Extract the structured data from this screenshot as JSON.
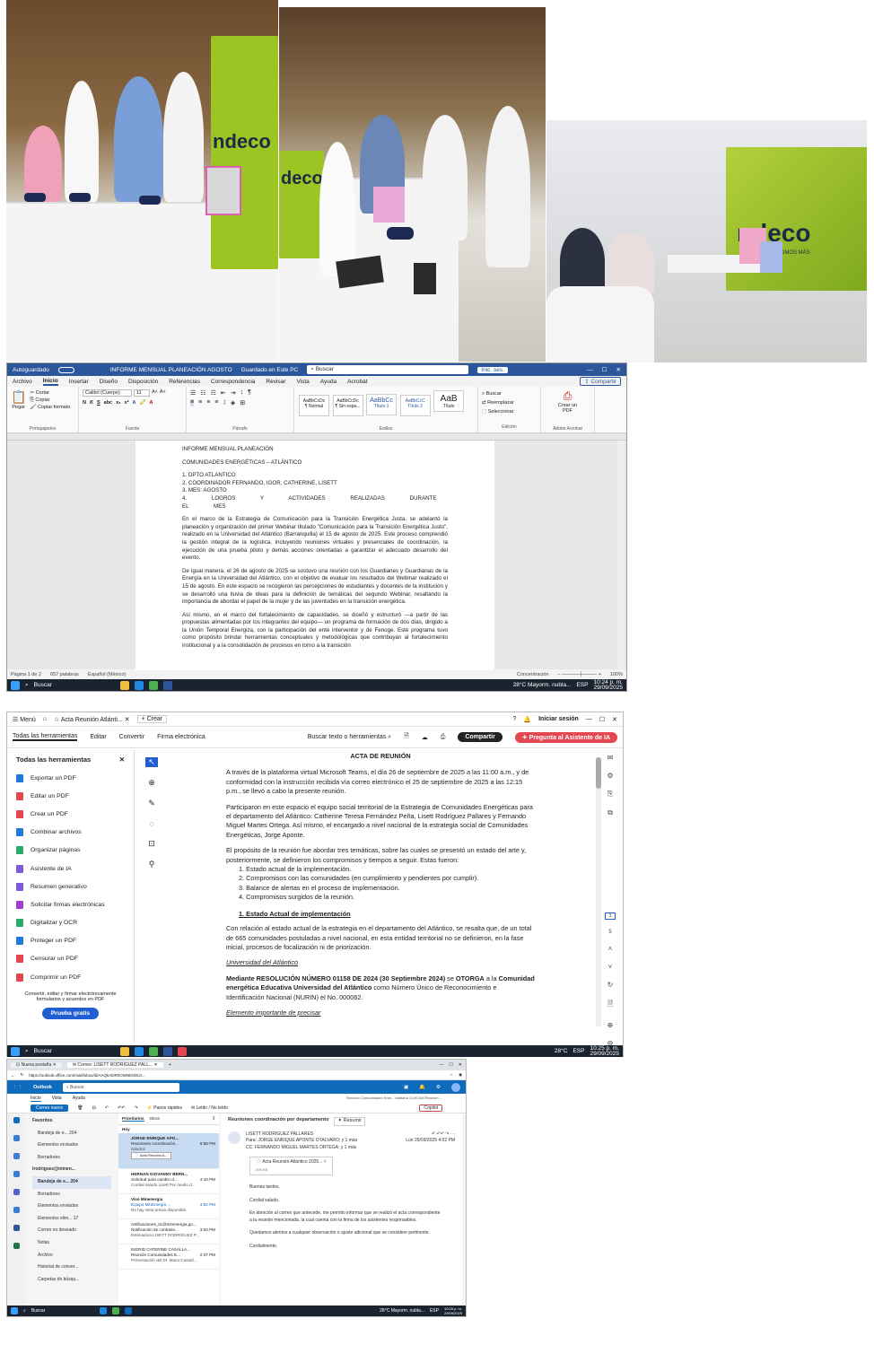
{
  "photos": {
    "banner_logo": "ndeco",
    "banner_sub": "UNIDOS, SOMOS MÁS"
  },
  "word": {
    "autosave": "Autoguardado",
    "doc_title": "INFORME MENSUAL PLANEACIÓN AGOSTO",
    "saved": "Guardado en Este PC",
    "search": "Buscar",
    "signin": "Inic. ses.",
    "share": "Compartir",
    "tabs": [
      "Archivo",
      "Inicio",
      "Insertar",
      "Diseño",
      "Disposición",
      "Referencias",
      "Correspondencia",
      "Revisar",
      "Vista",
      "Ayuda",
      "Acrobat"
    ],
    "ribbon": {
      "paste": "Pegar",
      "cut": "Cortar",
      "copy": "Copiar",
      "format": "Copiar formato",
      "clipboard": "Portapapeles",
      "font_name": "Calibri (Cuerpo)",
      "font_size": "11",
      "font_group": "Fuente",
      "paragraph_group": "Párrafo",
      "styles": [
        "AaBbCcDc",
        "AaBbCcDc",
        "AaBbCc",
        "AaBbCcC",
        "AaB"
      ],
      "style_names": [
        "¶ Normal",
        "¶ Sin espa...",
        "Título 1",
        "Título 2",
        "Título"
      ],
      "styles_group": "Estilos",
      "find": "Buscar",
      "replace": "Reemplazar",
      "select": "Seleccionar",
      "edit_group": "Edición",
      "create_pdf": "Crear un PDF",
      "adobe_group": "Adobe Acrobat"
    },
    "page": {
      "title": "INFORME MENSUAL PLANEACIÓN",
      "subtitle": "COMUNIDADES ENERGÉTICAS – ATLÁNTICO",
      "list": [
        "1.  DPTO ATLANTICO",
        "2.  COORDINADOR FERNANDO, IGOR, CATHERINE, LISETT",
        "3.  MES: AGOSTO",
        "4.  LOGROS Y ACTIVIDADES REALIZADAS DURANTE EL MES"
      ],
      "p1": "En el marco de la Estrategia de Comunicación para la Transición Energética Justa, se adelantó la planeación y organización del primer Webinar titulado \"Comunicación para la Transición Energética Justo\", realizado en la Universidad del Atlántico (Barranquilla) el 15 de agosto de 2025. Este proceso comprendió la gestión integral de la logística, incluyendo reuniones virtuales y presenciales de coordinación, la ejecución de una prueba piloto y demás acciones orientadas a garantizar el adecuado desarrollo del evento.",
      "p2": "De igual manera, el 26 de agosto de 2025 se sostuvo una reunión con los Guardianes y Guardianas de la Energía en la Universidad del Atlántico, con el objetivo de evaluar los resultados del Webinar realizado el 15 de agosto. En este espacio se recogieron las percepciones de estudiantes y docentes de la institución y se desarrolló una lluvia de ideas para la definición de temáticas del segundo Webinar, resaltando la importancia de abordar el papel de la mujer y de las juventudes en la transición energética.",
      "p3": "Así mismo, en el marco del fortalecimiento de capacidades, se diseñó y estructuró —a partir de las propuestas alimentadas por los integrantes del equipo— un programa de formación de dos días, dirigido a la Unión Temporal Energiza, con la participación del ente interventor y de Fenoge. Este programa tuvo como propósito brindar herramientas conceptuales y metodológicas que contribuyan al fortalecimiento institucional y a la consolidación de procesos en torno a la transición"
    },
    "status": {
      "page": "Página 1 de 2",
      "words": "657 palabras",
      "lang": "Español (México)",
      "focus": "Concentración",
      "zoom": "100%"
    }
  },
  "taskbar1": {
    "search": "Buscar",
    "weather": "28°C  Mayorm. nubla...",
    "lang": "ESP",
    "time": "10:24 p. m.",
    "date": "29/09/2025"
  },
  "acrobat": {
    "menu": "Menú",
    "tab": "Acta Reunión Atlánti...",
    "create": "Crear",
    "signin": "Iniciar sesión",
    "toolbar": [
      "Todas las herramientas",
      "Editar",
      "Convertir",
      "Firma electrónica"
    ],
    "search_tools": "Buscar texto o herramientas",
    "share": "Compartir",
    "ai": "Pregunta al Asistente de IA",
    "panel_title": "Todas las herramientas",
    "tools": [
      "Exportar un PDF",
      "Editar un PDF",
      "Crear un PDF",
      "Combinar archivos",
      "Organizar páginas",
      "Asistente de IA",
      "Resumen generativo",
      "Solicitar firmas electrónicas",
      "Digitalizar y OCR",
      "Proteger un PDF",
      "Censurar un PDF",
      "Comprimir un PDF"
    ],
    "promo": "Convertir, editar y firmar electrónicamente formularios y acuerdos en PDF",
    "trial": "Prueba gratis",
    "doc": {
      "title": "ACTA DE REUNIÓN",
      "p1": "A través de la plataforma virtual Microsoft Teams, el día 26 de septiembre de 2025 a las 11:00 a.m., y de conformidad con la instrucción recibida vía correo electrónico el 25 de septiembre de 2025 a las 12:15 p.m., se llevó a cabo la presente reunión.",
      "p2": "Participaron en este espacio el equipo social territorial de la Estrategia de Comunidades Energéticas para el departamento del Atlántico: Catherine Teresa Fernández Peña, Lisett Rodríguez Pallares y Fernando Miguel Martes Ortega. Así mismo, el encargado a nivel nacional de la estrategia social de Comunidades Energéticas, Jorge Aponte.",
      "p3": "El propósito de la reunión fue abordar tres temáticas, sobre las cuales se presentó un estado del arte y, posteriormente, se definieron los compromisos y tiempos a seguir. Estas fueron:",
      "list": [
        "1.  Estado actual de la implementación.",
        "2.  Compromisos con las comunidades (en cumplimiento y pendientes por cumplir).",
        "3.  Balance de alertas en el proceso de implementación.",
        "4.  Compromisos surgidos de la reunión."
      ],
      "h1": "1.   Estado Actual de implementación",
      "p4": "Con relación al estado actual de la estrategia en el departamento del Atlántico, se resalta que, de un total de 665 comunidades postuladas a nivel nacional, en esta entidad territorial no se definieron, en la fase inicial, procesos de focalización ni de priorización.",
      "u1": "Universidad del Atlántico",
      "p5a": "Mediante RESOLUCIÓN NÚMERO 01158 DE 2024 (30 Septiembre 2024)",
      "p5b": " se ",
      "p5c": "OTORGA",
      "p5d": " a la ",
      "p5e": "Comunidad energética Educativa Universidad del Atlántico",
      "p5f": " como Número Único de Reconocimiento e Identificación Nacional (NURIN) el No. 000062.",
      "u2": "Elemento importante de precisar"
    },
    "page_num": "1",
    "page_total": "5"
  },
  "taskbar2": {
    "search": "Buscar",
    "weather": "28°C",
    "lang": "ESP",
    "time": "10:25 p. m.",
    "date": "29/09/2025"
  },
  "outlook": {
    "tab1": "Nueva pestaña",
    "tab2": "Correo: LISETT RODRIGUEZ PALL...",
    "url": "https://outlook.office.com/mail/inbox/id/AAQkADRhOWNkNGUt...",
    "app": "Outlook",
    "search": "Buscar",
    "ribbon_tabs": [
      "Inicio",
      "Vista",
      "Ayuda"
    ],
    "new_mail": "Correo nuevo",
    "quick": "Pasos rápidos",
    "readunread": "Leído / No leído",
    "reminder": "Reunión Comunidades Ener... Mañana 11:00 AM Reunión ...",
    "copilot": "Copilot",
    "folders": [
      "Favoritos",
      "Bandeja de e...  204",
      "Elementos enviados",
      "Borradores",
      "lrodriguez@minen...",
      "Bandeja de e...  204",
      "Borradores",
      "Elementos enviados",
      "Elementos elim...  17",
      "Correo no deseado",
      "Notas",
      "Archivo",
      "Historial de conver...",
      "Carpetas de búsqu..."
    ],
    "list_tabs": [
      "Prioritarios",
      "Otros"
    ],
    "today": "Hoy",
    "messages": [
      {
        "from": "JORGE ENRIQUE APO...",
        "subject": "Reuniones coordinación...",
        "time": "9:56 PM",
        "preview": "saludos",
        "attach": "Acta Reunión A..."
      },
      {
        "from": "HERNAN GIOVANNY BERN...",
        "subject": "Solicitud para cambio d...",
        "time": "4:10 PM",
        "preview": "Cordial saludo Lisett Por medio d..."
      },
      {
        "from": "Vivo Minenergía",
        "subject": "Equipo MinEnergía ...",
        "time": "3:52 PM",
        "preview": "No hay vista previa disponible."
      },
      {
        "from": "notificaciones_tic@minenergia.go...",
        "subject": "Notificación de contrase...",
        "time": "3:03 PM",
        "preview": "Estimado/a LISETT RODRIGUEZ P..."
      },
      {
        "from": "INGRID CATERINE CASALLA...",
        "subject": "Reunión Comunidades E...",
        "time": "2:37 PM",
        "preview": "Presentación del Dr. Mario Castañ..."
      }
    ],
    "read": {
      "subject": "Reuniones coordinación por departamento",
      "summary": "Resumir",
      "from": "LISETT RODRIGUEZ PALLARES",
      "to": "Para: JORGE ENRIQUE APONTE OTALVARO; y 1 más",
      "cc": "CC: FERNANDO MIGUEL MARTES ORTEGA; y 1 más",
      "date": "Lun 29/09/2025 4:02 PM",
      "attachment": "Acta Reunión Atlántico 2025...",
      "attach_size": "206 KB",
      "body": [
        "Buenas tardes,",
        "Cordial saludo.",
        "En atención al correo que antecede, me permito informar que se realizó el acta correspondiente a la reunión mencionada, la cual cuenta con la firma de los asistentes responsables.",
        "Quedamos atentos a cualquier observación o ajuste adicional que se considere pertinente.",
        "Cordialmente,"
      ]
    }
  },
  "taskbar3": {
    "search": "Buscar",
    "weather": "28°C  Mayorm. nubla...",
    "lang": "ESP",
    "time": "10:25 p. m.",
    "date": "29/09/2025"
  }
}
